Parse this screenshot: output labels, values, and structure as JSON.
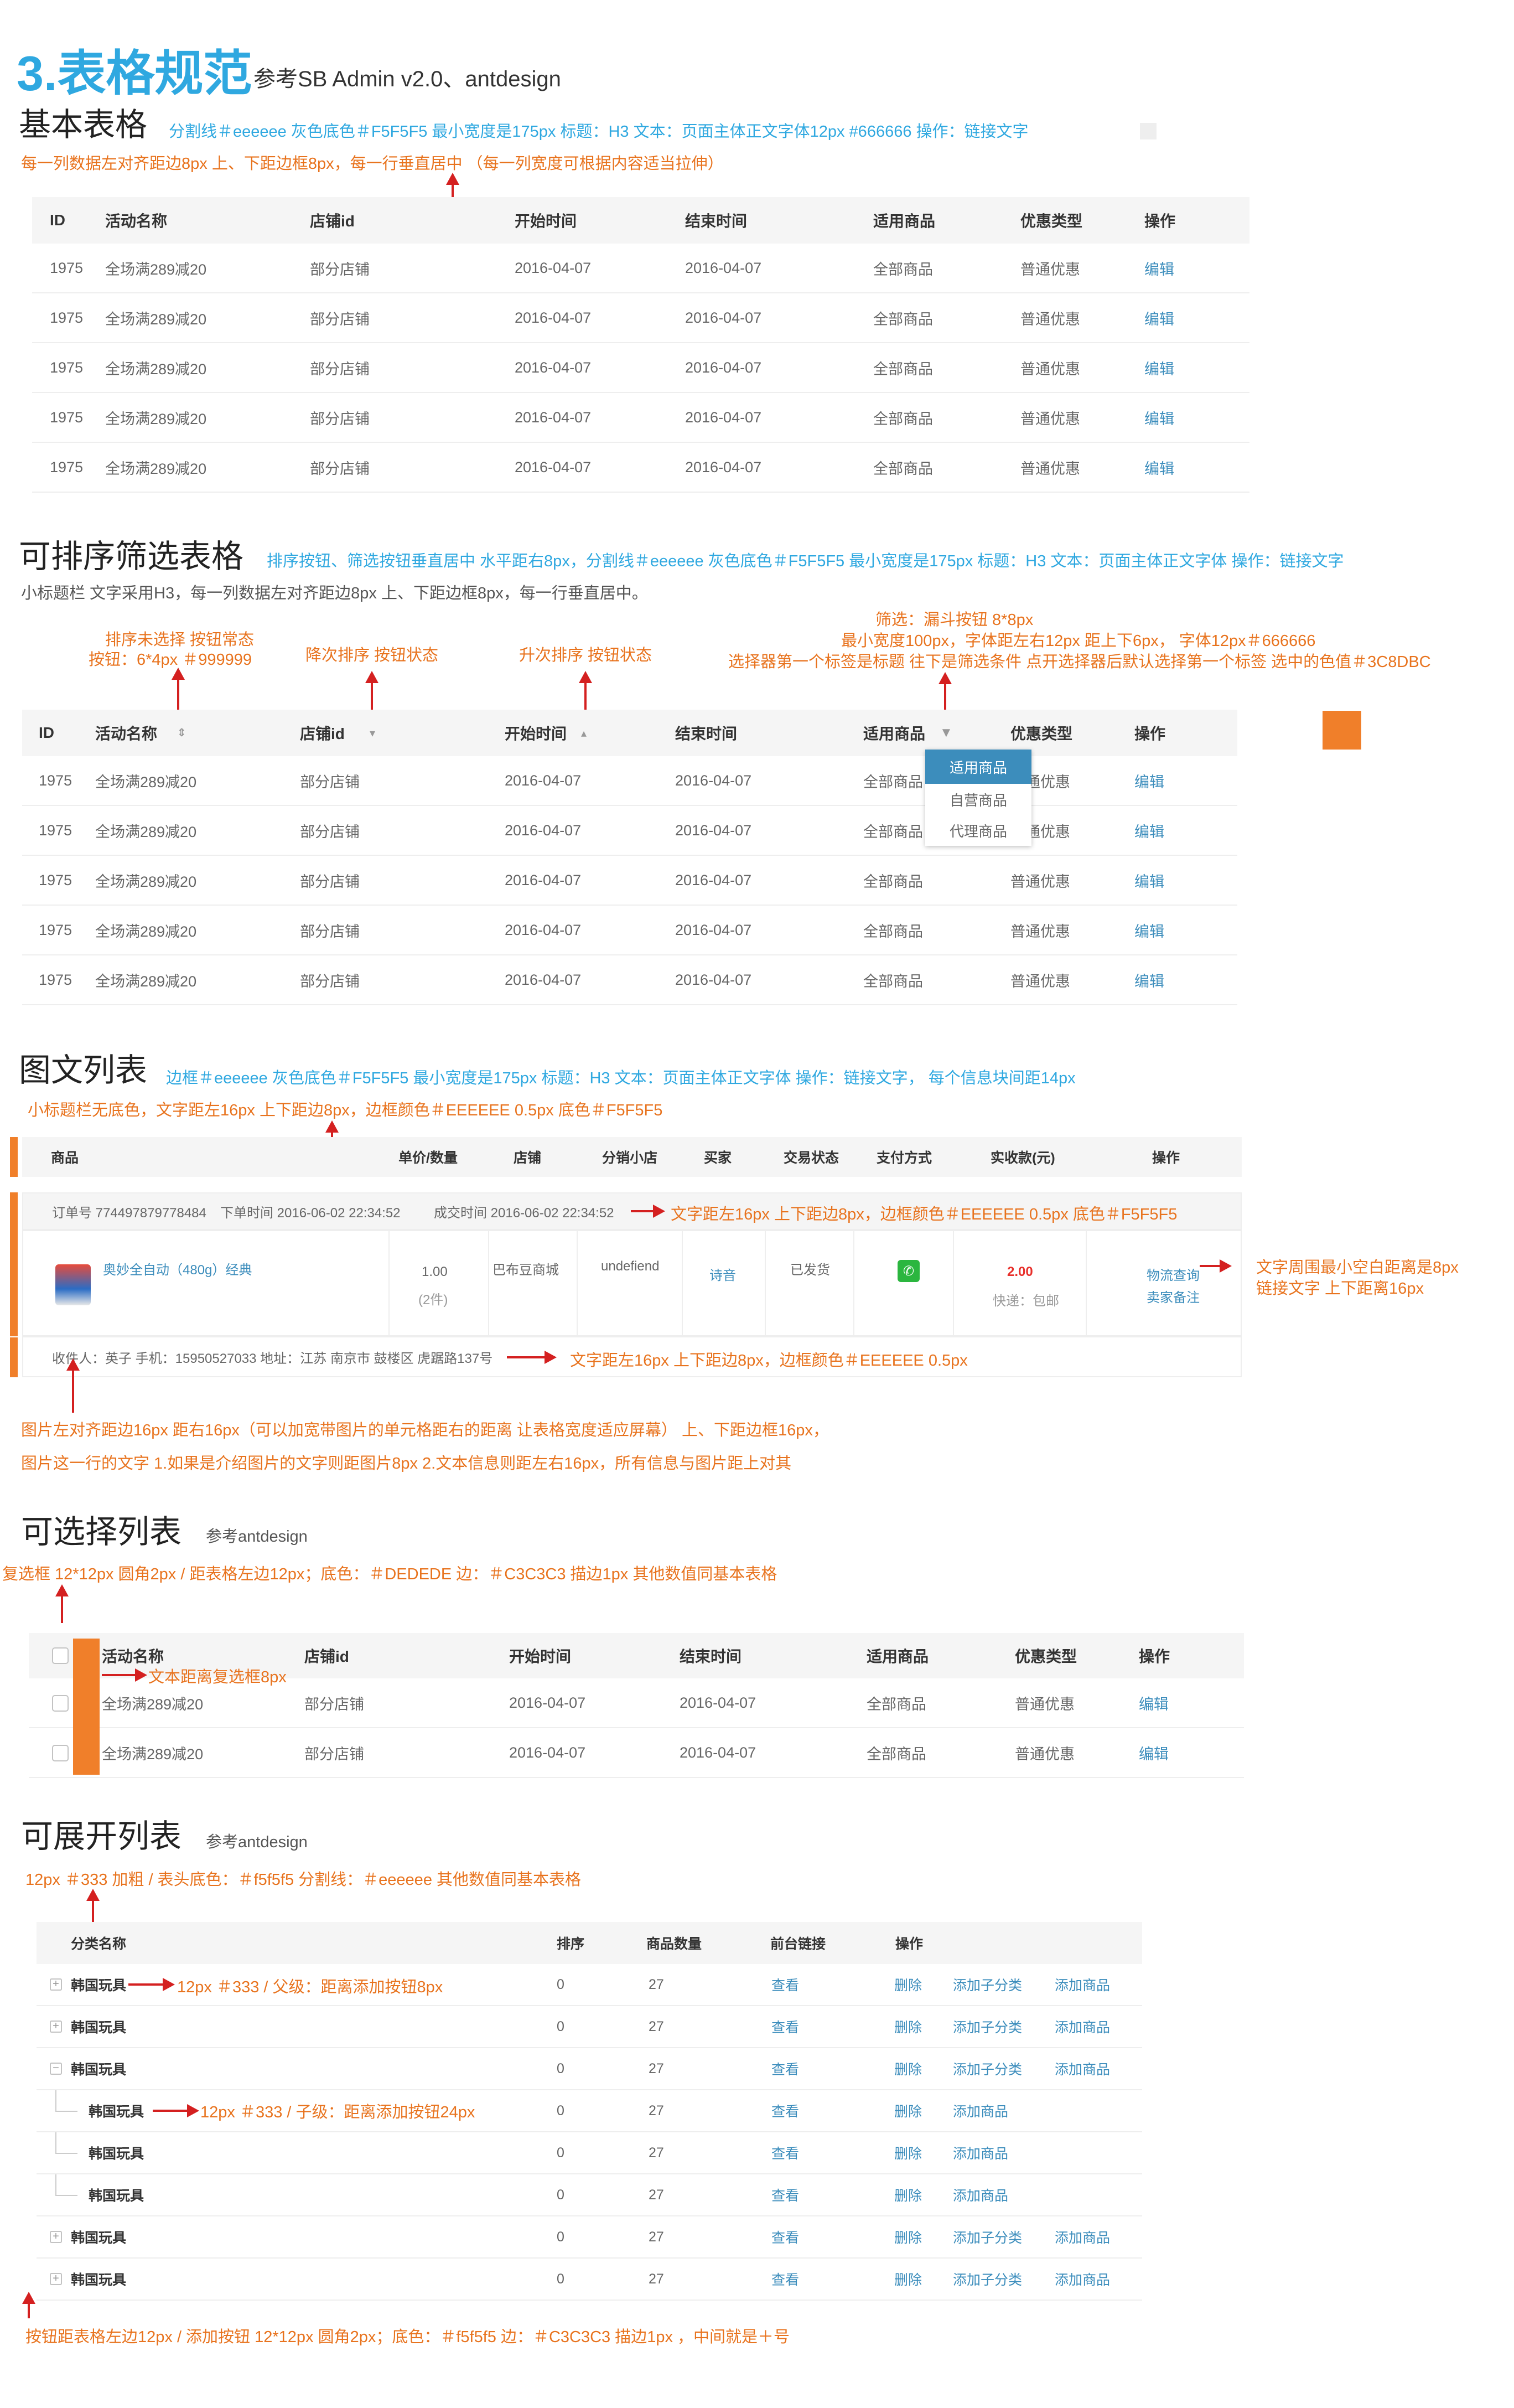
{
  "page": {
    "title_num": "3.表格规范",
    "title_ref": "参考SB Admin v2.0、antdesign"
  },
  "colors": {
    "accent_blue": "#2fa8e0",
    "accent_orange": "#e8731e",
    "arrow_red": "#d42020",
    "link": "#3c8dbc",
    "header_bg": "#f5f5f5",
    "divider": "#eeeeee"
  },
  "s1": {
    "title": "基本表格",
    "spec": "分割线＃eeeeee  灰色底色＃F5F5F5  最小宽度是175px  标题：H3  文本：页面主体正文字体12px #666666  操作：链接文字",
    "note": "每一列数据左对齐距边8px  上、下距边框8px，每一行垂直居中  （每一列宽度可根据内容适当拉伸）",
    "headers": [
      "ID",
      "活动名称",
      "店铺id",
      "开始时间",
      "结束时间",
      "适用商品",
      "优惠类型",
      "操作"
    ],
    "rows": [
      [
        "1975",
        "全场满289减20",
        "部分店铺",
        "2016-04-07",
        "2016-04-07",
        "全部商品",
        "普通优惠",
        "编辑"
      ],
      [
        "1975",
        "全场满289减20",
        "部分店铺",
        "2016-04-07",
        "2016-04-07",
        "全部商品",
        "普通优惠",
        "编辑"
      ],
      [
        "1975",
        "全场满289减20",
        "部分店铺",
        "2016-04-07",
        "2016-04-07",
        "全部商品",
        "普通优惠",
        "编辑"
      ],
      [
        "1975",
        "全场满289减20",
        "部分店铺",
        "2016-04-07",
        "2016-04-07",
        "全部商品",
        "普通优惠",
        "编辑"
      ],
      [
        "1975",
        "全场满289减20",
        "部分店铺",
        "2016-04-07",
        "2016-04-07",
        "全部商品",
        "普通优惠",
        "编辑"
      ]
    ]
  },
  "s2": {
    "title": "可排序筛选表格",
    "spec": "排序按钮、筛选按钮垂直居中 水平距右8px，分割线＃eeeeee  灰色底色＃F5F5F5  最小宽度是175px  标题：H3  文本：页面主体正文字体  操作：链接文字",
    "sub": "小标题栏   文字采用H3，每一列数据左对齐距边8px  上、下距边框8px，每一行垂直居中。",
    "ann_sort_default_1": "排序未选择 按钮常态",
    "ann_sort_default_2": "按钮：6*4px ＃999999",
    "ann_desc": "降次排序 按钮状态",
    "ann_asc": "升次排序 按钮状态",
    "ann_filter_1": "筛选：漏斗按钮 8*8px",
    "ann_filter_2": "最小宽度100px，字体距左右12px 距上下6px，  字体12px＃666666",
    "ann_filter_3": "选择器第一个标签是标题 往下是筛选条件 点开选择器后默认选择第一个标签 选中的色值＃3C8DBC",
    "headers": [
      "ID",
      "活动名称",
      "店铺id",
      "开始时间",
      "结束时间",
      "适用商品",
      "优惠类型",
      "操作"
    ],
    "rows": [
      [
        "1975",
        "全场满289减20",
        "部分店铺",
        "2016-04-07",
        "2016-04-07",
        "全部商品",
        "普通优惠",
        "编辑"
      ],
      [
        "1975",
        "全场满289减20",
        "部分店铺",
        "2016-04-07",
        "2016-04-07",
        "全部商品",
        "普通优惠",
        "编辑"
      ],
      [
        "1975",
        "全场满289减20",
        "部分店铺",
        "2016-04-07",
        "2016-04-07",
        "全部商品",
        "普通优惠",
        "编辑"
      ],
      [
        "1975",
        "全场满289减20",
        "部分店铺",
        "2016-04-07",
        "2016-04-07",
        "全部商品",
        "普通优惠",
        "编辑"
      ],
      [
        "1975",
        "全场满289减20",
        "部分店铺",
        "2016-04-07",
        "2016-04-07",
        "全部商品",
        "普通优惠",
        "编辑"
      ]
    ],
    "dropdown": [
      "适用商品",
      "自营商品",
      "代理商品"
    ]
  },
  "s3": {
    "title": "图文列表",
    "spec": "边框＃eeeeee  灰色底色＃F5F5F5  最小宽度是175px  标题：H3  文本：页面主体正文字体  操作：链接文字，  每个信息块间距14px",
    "note_top": "小标题栏无底色，文字距左16px 上下距边8px，边框颜色＃EEEEEE 0.5px  底色＃F5F5F5",
    "headers": [
      "商品",
      "单价/数量",
      "店铺",
      "分销小店",
      "买家",
      "交易状态",
      "支付方式",
      "实收款(元)",
      "操作"
    ],
    "order_no": "订单号 774497879778484",
    "order_time": "下单时间 2016-06-02 22:34:52",
    "deal_time": "成交时间 2016-06-02 22:34:52",
    "ann_order_bar": "文字距左16px 上下距边8px，边框颜色＃EEEEEE 0.5px  底色＃F5F5F5",
    "product_name": "奥妙全自动（480g）经典",
    "price": "1.00",
    "qty": "(2件)",
    "shop": "巴布豆商城",
    "mini_shop": "undefiend",
    "buyer": "诗音",
    "status": "已发货",
    "amount": "2.00",
    "shipping": "快递：包邮",
    "op1": "物流查询",
    "op2": "卖家备注",
    "ann_right_1": "文字周围最小空白距离是8px",
    "ann_right_2": "链接文字 上下距离16px",
    "receiver": "收件人：英子    手机：15950527033    地址：江苏 南京市 鼓楼区 虎踞路137号",
    "ann_receiver": "文字距左16px 上下距边8px，边框颜色＃EEEEEE 0.5px",
    "note_bottom_1": "图片左对齐距边16px  距右16px（可以加宽带图片的单元格距右的距离 让表格宽度适应屏幕）  上、下距边框16px，",
    "note_bottom_2": "图片这一行的文字   1.如果是介绍图片的文字则距图片8px   2.文本信息则距左右16px，所有信息与图片距上对其"
  },
  "s4": {
    "title": "可选择列表",
    "ref": "参考antdesign",
    "spec": "复选框  12*12px  圆角2px  /  距表格左边12px；底色：＃DEDEDE  边：＃C3C3C3 描边1px   其他数值同基本表格",
    "headers": [
      "活动名称",
      "店铺id",
      "开始时间",
      "结束时间",
      "适用商品",
      "优惠类型",
      "操作"
    ],
    "ann_text": "文本距离复选框8px",
    "rows": [
      [
        "全场满289减20",
        "部分店铺",
        "2016-04-07",
        "2016-04-07",
        "全部商品",
        "普通优惠",
        "编辑"
      ],
      [
        "全场满289减20",
        "部分店铺",
        "2016-04-07",
        "2016-04-07",
        "全部商品",
        "普通优惠",
        "编辑"
      ]
    ]
  },
  "s5": {
    "title": "可展开列表",
    "ref": "参考antdesign",
    "spec": "12px  ＃333 加粗  /  表头底色：＃f5f5f5  分割线：＃eeeeee  其他数值同基本表格",
    "headers": [
      "分类名称",
      "排序",
      "商品数量",
      "前台链接",
      "操作"
    ],
    "ann_parent": "12px  ＃333  /  父级：距离添加按钮8px",
    "ann_child": "12px  ＃333  /  子级：距离添加按钮24px",
    "rows": [
      {
        "name": "韩国玩具",
        "sort": "0",
        "count": "27",
        "link": "查看",
        "ops": [
          "删除",
          "添加子分类",
          "添加商品"
        ],
        "level": "parent",
        "icon": "+"
      },
      {
        "name": "韩国玩具",
        "sort": "0",
        "count": "27",
        "link": "查看",
        "ops": [
          "删除",
          "添加子分类",
          "添加商品"
        ],
        "level": "parent",
        "icon": "+"
      },
      {
        "name": "韩国玩具",
        "sort": "0",
        "count": "27",
        "link": "查看",
        "ops": [
          "删除",
          "添加子分类",
          "添加商品"
        ],
        "level": "parent",
        "icon": "−"
      },
      {
        "name": "韩国玩具",
        "sort": "0",
        "count": "27",
        "link": "查看",
        "ops": [
          "删除",
          "添加商品"
        ],
        "level": "child"
      },
      {
        "name": "韩国玩具",
        "sort": "0",
        "count": "27",
        "link": "查看",
        "ops": [
          "删除",
          "添加商品"
        ],
        "level": "child"
      },
      {
        "name": "韩国玩具",
        "sort": "0",
        "count": "27",
        "link": "查看",
        "ops": [
          "删除",
          "添加商品"
        ],
        "level": "child"
      },
      {
        "name": "韩国玩具",
        "sort": "0",
        "count": "27",
        "link": "查看",
        "ops": [
          "删除",
          "添加子分类",
          "添加商品"
        ],
        "level": "parent",
        "icon": "+"
      },
      {
        "name": "韩国玩具",
        "sort": "0",
        "count": "27",
        "link": "查看",
        "ops": [
          "删除",
          "添加子分类",
          "添加商品"
        ],
        "level": "parent",
        "icon": "+"
      }
    ],
    "bottom_note": "按钮距表格左边12px / 添加按钮 12*12px  圆角2px；底色：＃f5f5f5  边：＃C3C3C3 描边1px ，中间就是＋号"
  }
}
